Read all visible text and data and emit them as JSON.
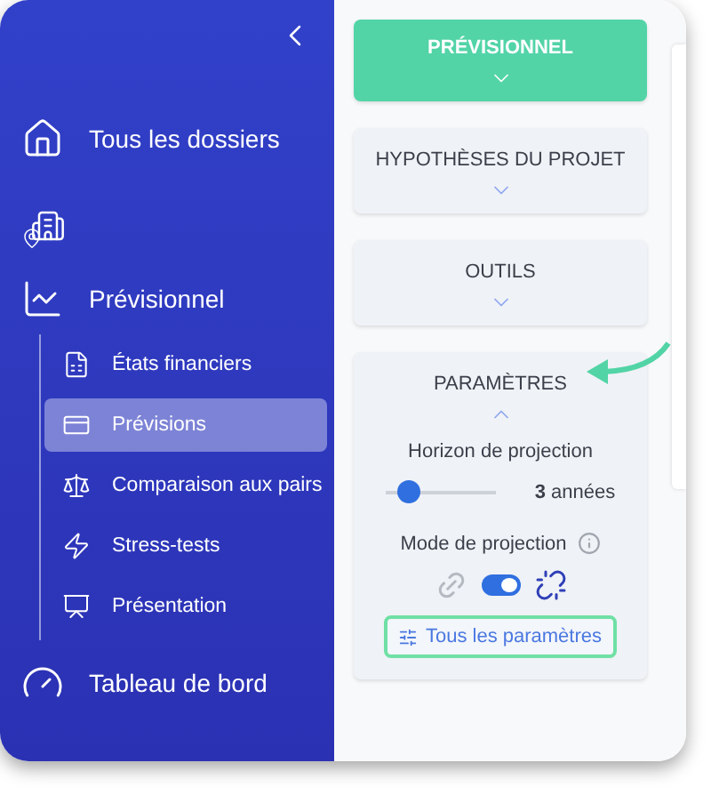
{
  "sidebar": {
    "items": [
      {
        "kind": "link",
        "label": "Tous les dossiers"
      },
      {
        "kind": "icon"
      },
      {
        "kind": "group",
        "label": "Prévisionnel",
        "children": [
          {
            "label": "États financiers",
            "selected": false
          },
          {
            "label": "Prévisions",
            "selected": true
          },
          {
            "label": "Comparaison aux pairs",
            "selected": false
          },
          {
            "label": "Stress-tests",
            "selected": false
          },
          {
            "label": "Présentation",
            "selected": false
          }
        ]
      },
      {
        "kind": "link",
        "label": "Tableau de bord"
      }
    ]
  },
  "sections": [
    {
      "title": "PRÉVISIONNEL",
      "selected": true,
      "expanded": false
    },
    {
      "title": "HYPOTHÈSES DU PROJET",
      "selected": false,
      "expanded": false
    },
    {
      "title": "OUTILS",
      "selected": false,
      "expanded": false
    },
    {
      "title": "PARAMÈTRES",
      "selected": false,
      "expanded": true
    }
  ],
  "parameters": {
    "horizon_label": "Horizon de projection",
    "horizon": {
      "level": 0.22
    },
    "horizon_value": "**3** années",
    "mode_label": "Mode de projection",
    "mode_toggle": {
      "on": true
    },
    "all_button": "Tous les paramètres"
  }
}
